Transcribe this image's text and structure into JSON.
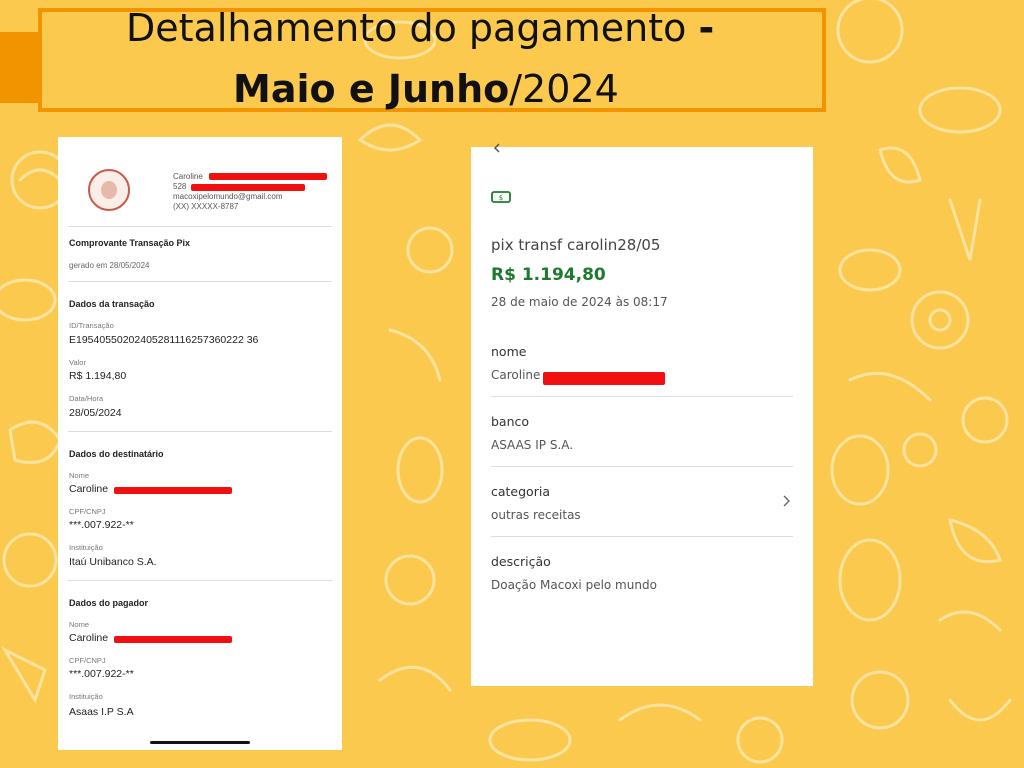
{
  "title": {
    "line1_normal": "Detalhamento do pagamento ",
    "line1_bold": "-",
    "line2_bold": "Maio e Junho",
    "line2_normal": "/2024"
  },
  "receipt": {
    "header": {
      "name": "Caroline",
      "doc": "528",
      "email": "macoxipelomundo@gmail.com",
      "phone": "(XX) XXXXX-8787"
    },
    "title": "Comprovante Transação Pix",
    "generated": "gerado em 28/05/2024",
    "transaction": {
      "section": "Dados da transação",
      "id_label": "ID/Transação",
      "id_value": "E19540550202405281116257360222 36",
      "value_label": "Valor",
      "value": "R$ 1.194,80",
      "date_label": "Data/Hora",
      "date": "28/05/2024"
    },
    "recipient": {
      "section": "Dados do destinatário",
      "name_label": "Nome",
      "name": "Caroline",
      "doc_label": "CPF/CNPJ",
      "doc": "***.007.922-**",
      "inst_label": "Instituição",
      "inst": "Itaú Unibanco S.A."
    },
    "payer": {
      "section": "Dados do pagador",
      "name_label": "Nome",
      "name": "Caroline",
      "doc_label": "CPF/CNPJ",
      "doc": "***.007.922-**",
      "inst_label": "Instituição",
      "inst": "Asaas I.P S.A"
    }
  },
  "panel": {
    "description": "pix transf carolin28/05",
    "amount": "R$ 1.194,80",
    "datetime": "28 de maio de 2024 às 08:17",
    "nome_label": "nome",
    "nome_value": "Caroline",
    "banco_label": "banco",
    "banco_value": "ASAAS IP S.A.",
    "categoria_label": "categoria",
    "categoria_value": "outras receitas",
    "descricao_label": "descrição",
    "descricao_value": "Doação Macoxi pelo mundo"
  },
  "colors": {
    "background": "#fbc94e",
    "accent_orange": "#f29400",
    "amount_green": "#1e7a2e",
    "redaction": "#f01010"
  },
  "icons": [
    "money-icon",
    "chevron-right-icon",
    "back-chevron-icon"
  ]
}
